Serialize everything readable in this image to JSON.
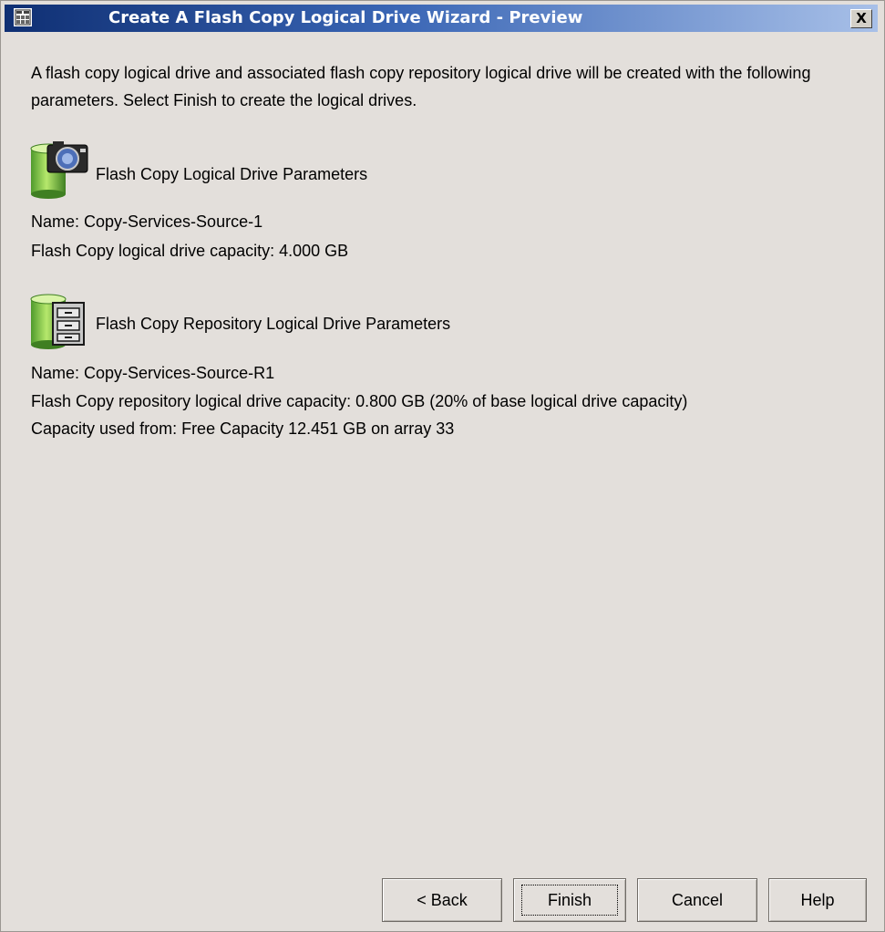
{
  "window": {
    "title": "Create A Flash Copy Logical Drive Wizard - Preview",
    "close_label": "X",
    "colors": {
      "titlebar_start": "#0f2f73",
      "titlebar_end": "#a8c0e8",
      "background": "#e3dfdb"
    }
  },
  "intro": {
    "text": "A flash copy logical drive and associated flash copy repository logical drive will be created with the following parameters. Select Finish to create the logical drives."
  },
  "flash_copy": {
    "icon": "flash-copy-camera-drive-icon",
    "title": "Flash Copy Logical Drive Parameters",
    "name_line": "Name: Copy-Services-Source-1",
    "capacity_line": "Flash Copy logical drive capacity: 4.000 GB"
  },
  "repository": {
    "icon": "repository-cabinet-drive-icon",
    "title": "Flash Copy Repository Logical Drive Parameters",
    "name_line": "Name: Copy-Services-Source-R1",
    "capacity_line": "Flash Copy repository logical drive capacity: 0.800 GB (20% of base logical drive capacity)",
    "source_line": "Capacity used from: Free Capacity 12.451 GB on array 33"
  },
  "buttons": {
    "back": "< Back",
    "finish": "Finish",
    "cancel": "Cancel",
    "help": "Help"
  }
}
